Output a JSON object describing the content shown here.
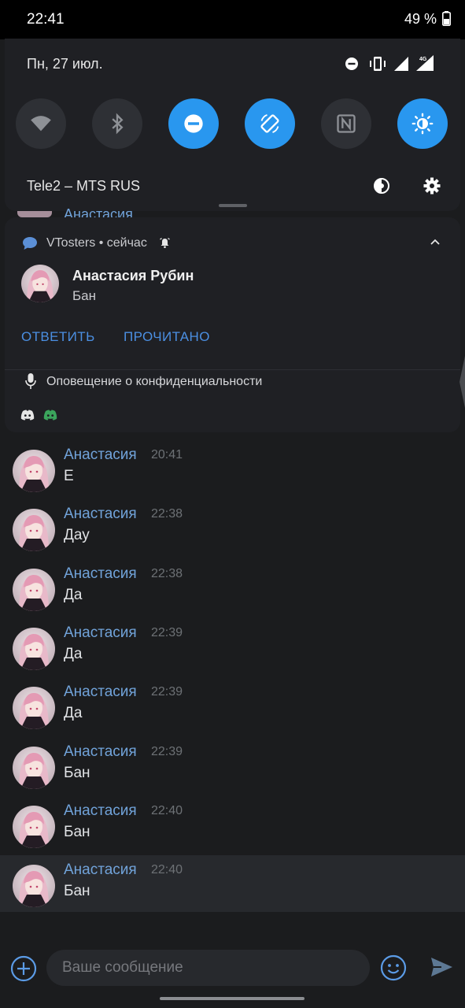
{
  "status_bar": {
    "time": "22:41",
    "battery": "49 %"
  },
  "quick_settings": {
    "date": "Пн, 27 июл.",
    "carrier": "Tele2 – MTS RUS",
    "tiles": [
      {
        "icon": "wifi-icon",
        "active": false
      },
      {
        "icon": "bluetooth-icon",
        "active": false
      },
      {
        "icon": "do-not-disturb-icon",
        "active": true
      },
      {
        "icon": "auto-rotate-icon",
        "active": true
      },
      {
        "icon": "nfc-icon",
        "active": false
      },
      {
        "icon": "night-light-icon",
        "active": true
      }
    ]
  },
  "peek_row": {
    "name": "Анастасия"
  },
  "notification": {
    "app": "VTosters",
    "when": "• сейчас",
    "sender": "Анастасия Рубин",
    "text": "Бан",
    "actions": [
      "ОТВЕТИТЬ",
      "ПРОЧИТАНО"
    ],
    "privacy": "Оповещение о конфиденциальности"
  },
  "messages": [
    {
      "name": "Анастасия",
      "time": "20:41",
      "text": "Е"
    },
    {
      "name": "Анастасия",
      "time": "22:38",
      "text": "Дау"
    },
    {
      "name": "Анастасия",
      "time": "22:38",
      "text": "Да"
    },
    {
      "name": "Анастасия",
      "time": "22:39",
      "text": "Да"
    },
    {
      "name": "Анастасия",
      "time": "22:39",
      "text": "Да"
    },
    {
      "name": "Анастасия",
      "time": "22:39",
      "text": "Бан"
    },
    {
      "name": "Анастасия",
      "time": "22:40",
      "text": "Бан"
    },
    {
      "name": "Анастасия",
      "time": "22:40",
      "text": "Бан"
    }
  ],
  "composer": {
    "placeholder": "Ваше сообщение"
  },
  "colors": {
    "accent": "#2997ef",
    "link": "#71a3da",
    "background": "#1b1c1e"
  }
}
